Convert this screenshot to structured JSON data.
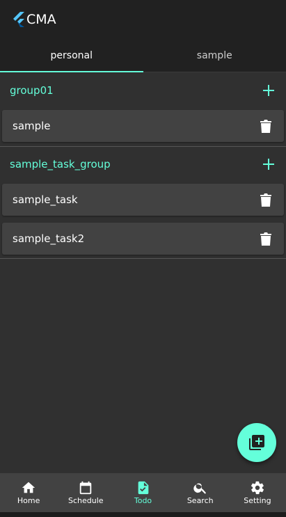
{
  "app": {
    "title": "CMA"
  },
  "tabs": [
    {
      "label": "personal",
      "active": true
    },
    {
      "label": "sample",
      "active": false
    }
  ],
  "groups": [
    {
      "title": "group01",
      "tasks": [
        {
          "label": "sample"
        }
      ]
    },
    {
      "title": "sample_task_group",
      "tasks": [
        {
          "label": "sample_task"
        },
        {
          "label": "sample_task2"
        }
      ]
    }
  ],
  "bottom_nav": [
    {
      "label": "Home",
      "icon": "home-icon",
      "active": false
    },
    {
      "label": "Schedule",
      "icon": "calendar-icon",
      "active": false
    },
    {
      "label": "Todo",
      "icon": "todo-icon",
      "active": true
    },
    {
      "label": "Search",
      "icon": "search-icon",
      "active": false
    },
    {
      "label": "Setting",
      "icon": "gear-icon",
      "active": false
    }
  ],
  "colors": {
    "accent": "#64ffda",
    "background": "#303030",
    "appbar": "#212121",
    "card": "#424242"
  }
}
